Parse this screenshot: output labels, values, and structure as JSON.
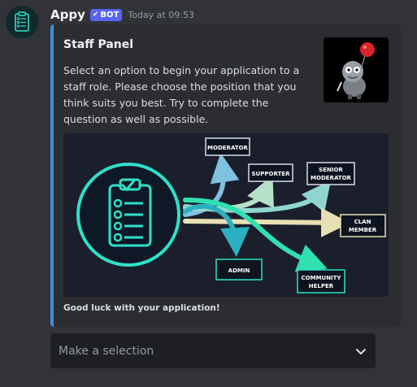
{
  "message": {
    "author": "Appy",
    "badge": "BOT",
    "timestamp": "Today at 09:53"
  },
  "embed": {
    "title": "Staff Panel",
    "description": "Select an option to begin your application to a staff role. Please choose the position that you think suits you best. Try to complete the question as well as possible.",
    "footer": "Good luck with your application!",
    "accent_color": "#3a8ed6",
    "image": {
      "roles": {
        "moderator": "MODERATOR",
        "supporter": "SUPPORTER",
        "senior_1": "SENIOR",
        "senior_2": "MODERATOR",
        "clan_1": "CLAN",
        "clan_2": "MEMBER",
        "admin": "ADMIN",
        "community_1": "COMMUNITY",
        "community_2": "HELPER"
      }
    }
  },
  "select_menu": {
    "placeholder": "Make a selection",
    "icon": "chevron-down-icon"
  }
}
